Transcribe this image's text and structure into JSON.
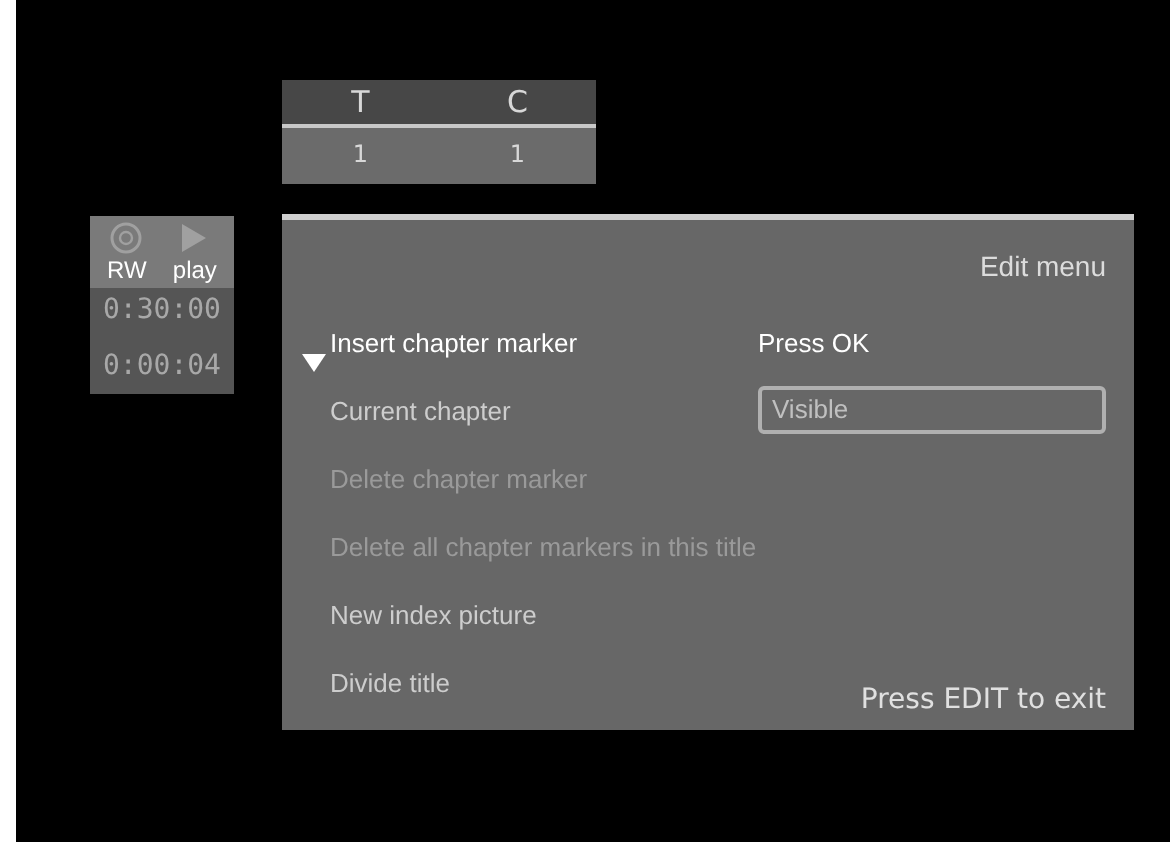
{
  "title_chapter": {
    "columns": [
      {
        "label": "T",
        "value": "1"
      },
      {
        "label": "C",
        "value": "1"
      }
    ]
  },
  "status": {
    "modes": [
      {
        "label": "RW",
        "kind": "disc"
      },
      {
        "label": "play",
        "kind": "play"
      }
    ],
    "times": [
      "0:30:00",
      "0:00:04"
    ]
  },
  "menu": {
    "title": "Edit menu",
    "items": [
      {
        "label": "Insert chapter marker",
        "selected": true,
        "disabled": false,
        "kind": "action",
        "value": "Press OK"
      },
      {
        "label": "Current chapter",
        "selected": false,
        "disabled": false,
        "kind": "field",
        "value": "Visible"
      },
      {
        "label": "Delete chapter marker",
        "selected": false,
        "disabled": true,
        "kind": "plain"
      },
      {
        "label": "Delete all chapter markers in this title",
        "selected": false,
        "disabled": true,
        "kind": "plain"
      },
      {
        "label": "New index picture",
        "selected": false,
        "disabled": false,
        "kind": "plain"
      },
      {
        "label": "Divide title",
        "selected": false,
        "disabled": false,
        "kind": "plain"
      }
    ],
    "hint": "Press EDIT to exit"
  }
}
